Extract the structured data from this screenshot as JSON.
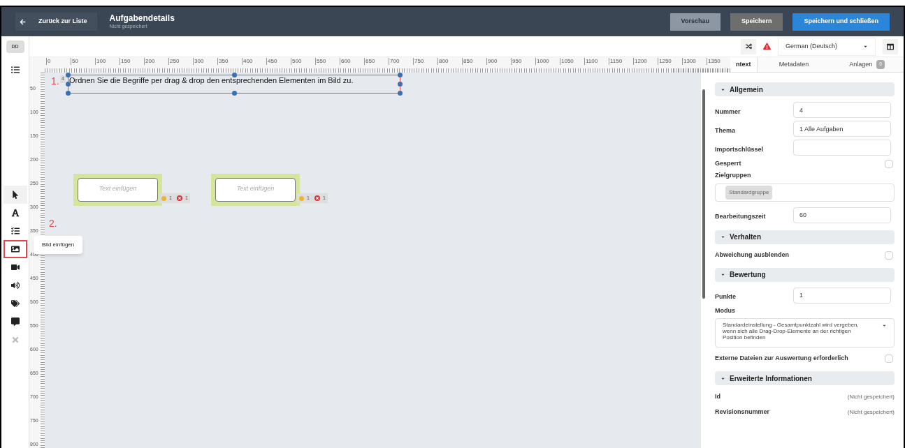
{
  "header": {
    "back_button": {
      "label": "Zurück zur Liste"
    },
    "title": "Aufgabendetails",
    "subtitle": "Nicht gespeichert",
    "buttons": [
      {
        "label": "Vorschau",
        "kind": "disabled"
      },
      {
        "label": "Speichern",
        "kind": "secondary"
      },
      {
        "label": "Speichern und schließen",
        "kind": "primary"
      }
    ]
  },
  "avatar": "DD",
  "toolbar": {
    "language": "German (Deutsch)"
  },
  "tools": [
    {
      "kind": "pointer",
      "highlighted": false
    },
    {
      "kind": "text",
      "highlighted": false
    },
    {
      "kind": "checklist",
      "highlighted": false
    },
    {
      "kind": "image",
      "highlighted": true
    },
    {
      "kind": "video",
      "highlighted": false
    },
    {
      "kind": "audio",
      "highlighted": false
    },
    {
      "kind": "tags",
      "highlighted": false
    },
    {
      "kind": "comment",
      "highlighted": false
    },
    {
      "kind": "delete",
      "highlighted": false
    }
  ],
  "tooltip": "Bild einfügen",
  "ruler_h": [
    "0",
    "50",
    "100",
    "150",
    "200",
    "250",
    "300",
    "350",
    "400",
    "450",
    "500",
    "550",
    "600",
    "650",
    "700",
    "750",
    "800",
    "850",
    "900",
    "950",
    "1000",
    "1050",
    "1100",
    "1150",
    "1200",
    "1250",
    "1300",
    "1350"
  ],
  "ruler_v": [
    "50",
    "100",
    "150",
    "200",
    "250",
    "300",
    "350",
    "400",
    "450",
    "500",
    "550",
    "600",
    "650",
    "700",
    "750",
    "800"
  ],
  "canvas": {
    "annotations": [
      "1.",
      "2."
    ],
    "question": {
      "number": "4",
      "text": "Ordnen Sie die Begriffe per drag & drop den entsprechenden Elementen im Bild zu."
    },
    "drop_zones": [
      {
        "placeholder": "Text einfügen",
        "correct": "1",
        "wrong": "1"
      },
      {
        "placeholder": "Text einfügen",
        "correct": "1",
        "wrong": "1"
      }
    ]
  },
  "panel": {
    "tabs": [
      {
        "label": "ntext",
        "selected": true
      },
      {
        "label": "Metadaten",
        "selected": false
      },
      {
        "label": "Anlagen",
        "selected": false,
        "badge": "0"
      }
    ],
    "sections": [
      {
        "title": "Allgemein",
        "rows": [
          {
            "kind": "input",
            "label": "Nummer",
            "value": "4"
          },
          {
            "kind": "input",
            "label": "Thema",
            "value": "1 Alle Aufgaben"
          },
          {
            "kind": "input",
            "label": "Importschlüssel"
          },
          {
            "kind": "checkbox",
            "label": "Gesperrt",
            "checked": false
          },
          {
            "kind": "tags",
            "label": "Zielgruppen",
            "tags": [
              "Standardgruppe"
            ]
          },
          {
            "kind": "input",
            "label": "Bearbeitungszeit",
            "value": "60"
          }
        ]
      },
      {
        "title": "Verhalten",
        "rows": [
          {
            "kind": "checkbox",
            "label": "Abweichung ausblenden",
            "checked": false
          }
        ]
      },
      {
        "title": "Bewertung",
        "rows": [
          {
            "kind": "input",
            "label": "Punkte",
            "value": "1"
          },
          {
            "kind": "select",
            "label": "Modus",
            "value": "Standardeinstellung - Gesamtpunktzahl wird vergeben, wenn sich alle Drag-Drop-Elemente an der richtigen Position befinden"
          },
          {
            "kind": "checkbox",
            "label": "Externe Dateien zur Auswertung erforderlich",
            "checked": false
          }
        ]
      },
      {
        "title": "Erweiterte Informationen",
        "rows": [
          {
            "kind": "info",
            "label": "Id",
            "value": "(Nicht gespeichert)"
          },
          {
            "kind": "info",
            "label": "Revisionsnummer",
            "value": "(Nicht gespeichert)"
          }
        ]
      }
    ]
  }
}
